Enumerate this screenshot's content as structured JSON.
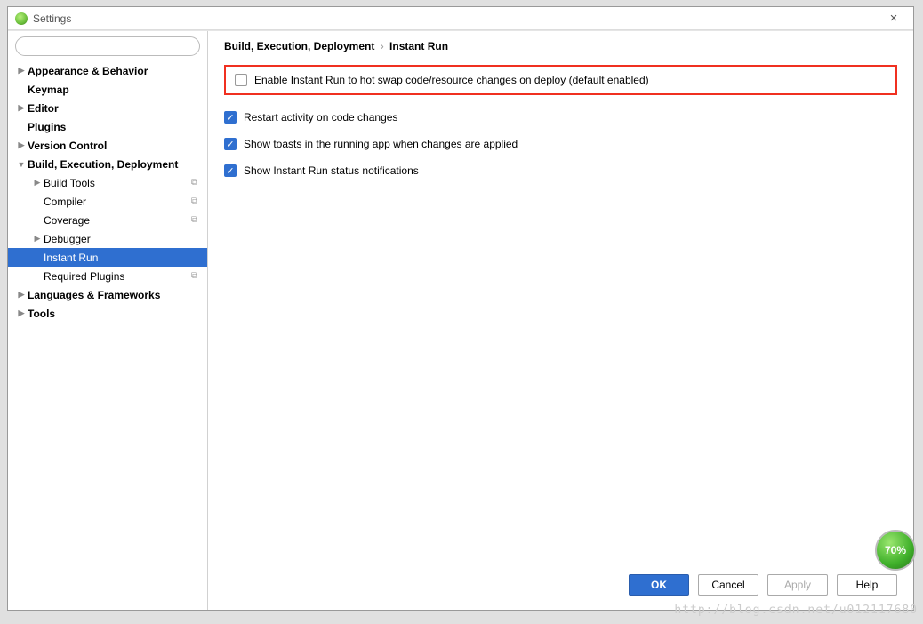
{
  "window": {
    "title": "Settings"
  },
  "breadcrumb": {
    "parent": "Build, Execution, Deployment",
    "current": "Instant Run"
  },
  "sidebar": {
    "items": [
      {
        "label": "Appearance & Behavior",
        "lvl": 0,
        "arrow": "▶",
        "bold": true
      },
      {
        "label": "Keymap",
        "lvl": 0,
        "arrow": "",
        "bold": true
      },
      {
        "label": "Editor",
        "lvl": 0,
        "arrow": "▶",
        "bold": true
      },
      {
        "label": "Plugins",
        "lvl": 0,
        "arrow": "",
        "bold": true
      },
      {
        "label": "Version Control",
        "lvl": 0,
        "arrow": "▶",
        "bold": true
      },
      {
        "label": "Build, Execution, Deployment",
        "lvl": 0,
        "arrow": "▼",
        "bold": true
      },
      {
        "label": "Build Tools",
        "lvl": 1,
        "arrow": "▶",
        "badge": true
      },
      {
        "label": "Compiler",
        "lvl": 1,
        "arrow": "",
        "badge": true
      },
      {
        "label": "Coverage",
        "lvl": 1,
        "arrow": "",
        "badge": true
      },
      {
        "label": "Debugger",
        "lvl": 1,
        "arrow": "▶"
      },
      {
        "label": "Instant Run",
        "lvl": 1,
        "arrow": "",
        "selected": true
      },
      {
        "label": "Required Plugins",
        "lvl": 1,
        "arrow": "",
        "badge": true
      },
      {
        "label": "Languages & Frameworks",
        "lvl": 0,
        "arrow": "▶",
        "bold": true
      },
      {
        "label": "Tools",
        "lvl": 0,
        "arrow": "▶",
        "bold": true
      }
    ]
  },
  "options": {
    "enable": {
      "checked": false,
      "label": "Enable Instant Run to hot swap code/resource changes on deploy (default enabled)"
    },
    "restart": {
      "checked": true,
      "label": "Restart activity on code changes"
    },
    "toasts": {
      "checked": true,
      "label": "Show toasts in the running app when changes are applied"
    },
    "status": {
      "checked": true,
      "label": "Show Instant Run status notifications"
    }
  },
  "buttons": {
    "ok": "OK",
    "cancel": "Cancel",
    "apply": "Apply",
    "help": "Help"
  },
  "progress": "70%",
  "watermark": "http://blog.csdn.net/u012117680"
}
